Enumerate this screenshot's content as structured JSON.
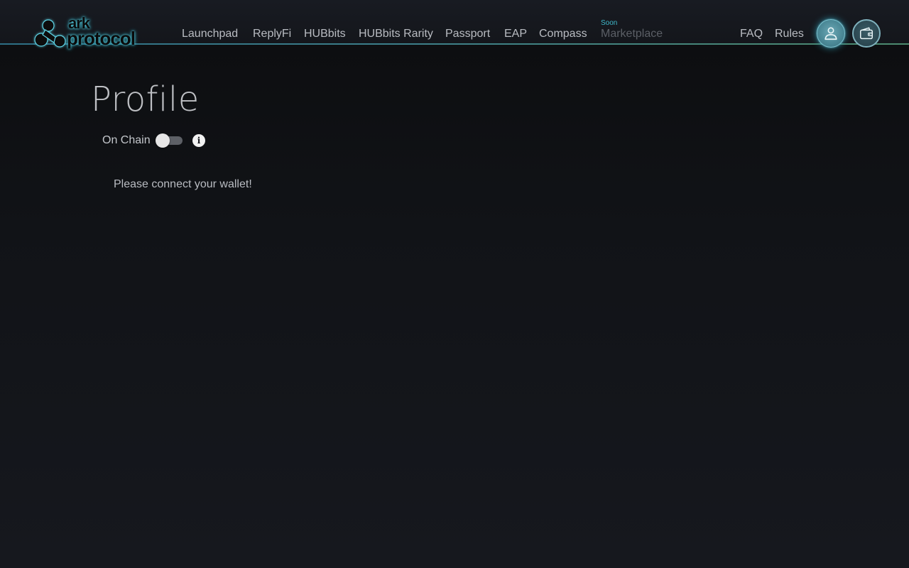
{
  "brand": {
    "logo_line1": "ark",
    "logo_line2": "protocol",
    "accent_color": "#3fb8c9"
  },
  "nav": {
    "items": [
      {
        "label": "Launchpad",
        "enabled": true
      },
      {
        "label": "ReplyFi",
        "enabled": true
      },
      {
        "label": "HUBbits",
        "enabled": true
      },
      {
        "label": "HUBbits Rarity",
        "enabled": true
      },
      {
        "label": "Passport",
        "enabled": true
      },
      {
        "label": "EAP",
        "enabled": true
      },
      {
        "label": "Compass",
        "enabled": true
      },
      {
        "label": "Marketplace",
        "enabled": false,
        "badge": "Soon"
      }
    ],
    "right_items": [
      {
        "label": "FAQ"
      },
      {
        "label": "Rules"
      }
    ],
    "profile_icon": "user-icon",
    "wallet_icon": "wallet-icon"
  },
  "main": {
    "title": "Profile",
    "on_chain": {
      "label": "On Chain",
      "enabled": false,
      "info_icon": "info-icon"
    },
    "message": "Please connect your wallet!"
  }
}
